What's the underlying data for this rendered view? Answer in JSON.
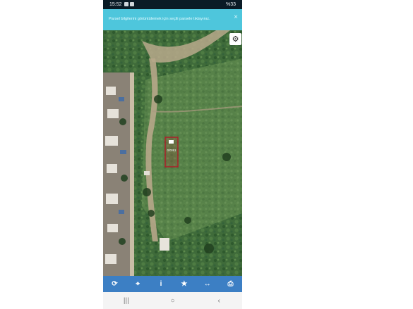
{
  "status_bar": {
    "time": "15:52",
    "right_text": "%33"
  },
  "banner": {
    "message": "Parsel bilgilerini görüntülemek için seçili parsele tıklayınız.",
    "close_symbol": "×"
  },
  "map": {
    "parcel_label": "0/0061",
    "parcel_color": "#b01c28",
    "settings_icon": "gear-icon"
  },
  "toolbar": {
    "color": "#3c7fc4",
    "items": [
      {
        "icon": "refresh-icon",
        "glyph": "⟳"
      },
      {
        "icon": "locate-icon",
        "glyph": "⌖"
      },
      {
        "icon": "info-icon",
        "glyph": "i"
      },
      {
        "icon": "star-icon",
        "glyph": "★"
      },
      {
        "icon": "measure-icon",
        "glyph": "↔"
      },
      {
        "icon": "print-icon",
        "glyph": "⎙"
      }
    ]
  },
  "nav_bar": {
    "items": [
      {
        "icon": "recent-apps-icon",
        "glyph": "|||"
      },
      {
        "icon": "home-icon",
        "glyph": "○"
      },
      {
        "icon": "back-icon",
        "glyph": "‹"
      }
    ]
  }
}
